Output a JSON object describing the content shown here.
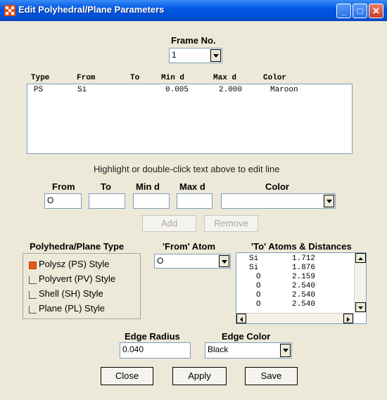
{
  "window": {
    "title": "Edit Polyhedral/Plane Parameters"
  },
  "frame": {
    "label": "Frame No.",
    "value": "1"
  },
  "table": {
    "headers": [
      "Type",
      "From",
      "To",
      "Min d",
      "Max d",
      "Color"
    ],
    "rows": [
      {
        "type": "PS",
        "from": "Si",
        "to": "",
        "min_d": "0.005",
        "max_d": "2.000",
        "color": "Maroon"
      }
    ]
  },
  "hint": "Highlight or double-click text above to edit line",
  "edit": {
    "from_label": "From",
    "from_value": "O",
    "to_label": "To",
    "to_value": "",
    "min_label": "Min d",
    "min_value": "",
    "max_label": "Max d",
    "max_value": "",
    "color_label": "Color",
    "color_value": ""
  },
  "buttons": {
    "add": "Add",
    "remove": "Remove",
    "close": "Close",
    "apply": "Apply",
    "save": "Save"
  },
  "poly_type": {
    "title": "Polyhedra/Plane Type",
    "options": [
      {
        "label": "Polysz (PS) Style",
        "selected": true
      },
      {
        "label": "Polyvert (PV) Style",
        "selected": false
      },
      {
        "label": "Shell (SH) Style",
        "selected": false
      },
      {
        "label": "Plane (PL) Style",
        "selected": false
      }
    ]
  },
  "from_atom": {
    "title": "'From' Atom",
    "value": "O"
  },
  "to_atoms": {
    "title": "'To' Atoms & Distances",
    "rows": [
      {
        "atom": "Si",
        "dist": "1.712"
      },
      {
        "atom": "Si",
        "dist": "1.876"
      },
      {
        "atom": "O",
        "dist": "2.159"
      },
      {
        "atom": "O",
        "dist": "2.540"
      },
      {
        "atom": "O",
        "dist": "2.540"
      },
      {
        "atom": "O",
        "dist": "2.540"
      }
    ]
  },
  "edge": {
    "radius_label": "Edge Radius",
    "radius_value": "0.040",
    "color_label": "Edge Color",
    "color_value": "Black"
  },
  "colors": {
    "title_bar": "#0058e6",
    "window_bg": "#ece9d8",
    "selected_radio": "#e8551a"
  }
}
